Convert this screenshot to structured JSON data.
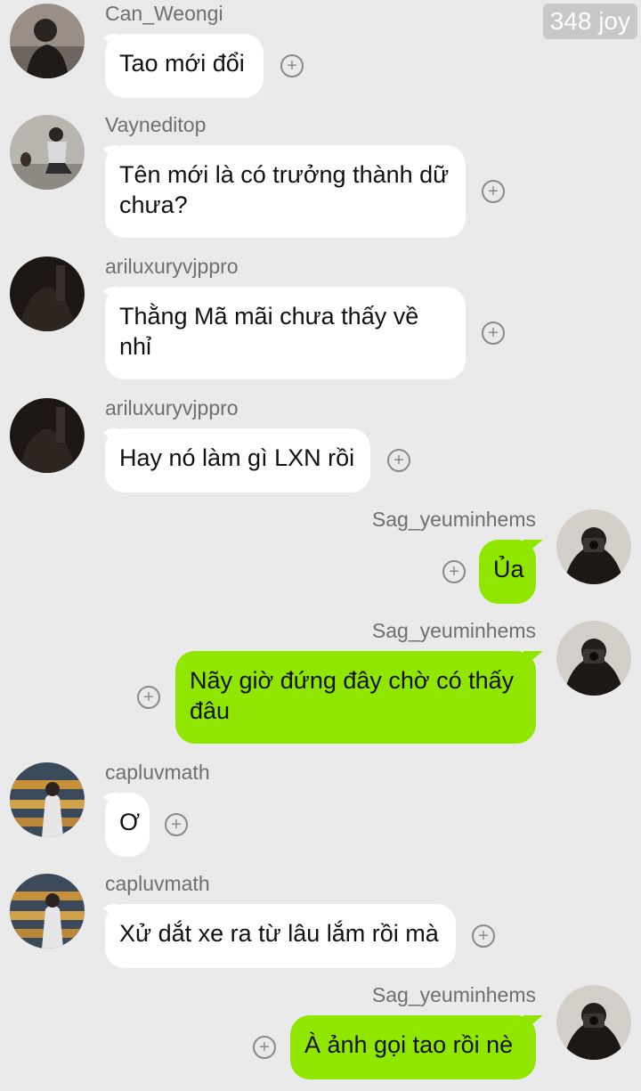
{
  "header": {
    "badge": "348 joy"
  },
  "messages": [
    {
      "side": "left",
      "sender": "Can_Weongi",
      "text": "Tao mới đổi",
      "avatar": "avatar-can-weongi"
    },
    {
      "side": "left",
      "sender": "Vayneditop",
      "text": "Tên mới là có trưởng thành dữ chưa?",
      "avatar": "avatar-vayneditop"
    },
    {
      "side": "left",
      "sender": "ariluxuryvjppro",
      "text": "Thằng Mã mãi chưa thấy về nhỉ",
      "avatar": "avatar-ariluxury"
    },
    {
      "side": "left",
      "sender": "ariluxuryvjppro",
      "text": "Hay nó làm gì LXN rồi",
      "avatar": "avatar-ariluxury"
    },
    {
      "side": "right",
      "sender": "Sag_yeuminhems",
      "text": "Ủa",
      "avatar": "avatar-sag"
    },
    {
      "side": "right",
      "sender": "Sag_yeuminhems",
      "text": "Nãy giờ đứng đây chờ có thấy đâu",
      "avatar": "avatar-sag"
    },
    {
      "side": "left",
      "sender": "capluvmath",
      "text": "Ơ",
      "avatar": "avatar-capluvmath"
    },
    {
      "side": "left",
      "sender": "capluvmath",
      "text": "Xử dắt xe ra từ lâu lắm rồi mà",
      "avatar": "avatar-capluvmath"
    },
    {
      "side": "right",
      "sender": "Sag_yeuminhems",
      "text": "À ảnh gọi tao rồi nè",
      "avatar": "avatar-sag"
    }
  ],
  "react_icon": "+",
  "colors": {
    "background": "#eaeaea",
    "outgoing_bubble": "#91e600",
    "incoming_bubble": "#ffffff"
  }
}
